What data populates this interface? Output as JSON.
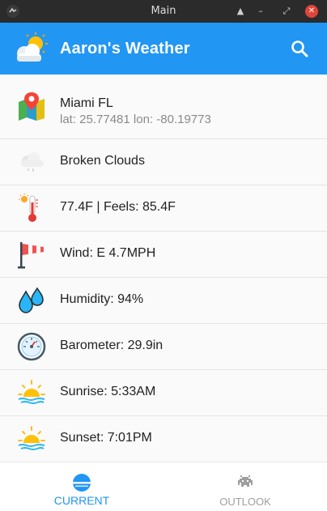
{
  "window": {
    "title": "Main"
  },
  "app": {
    "title": "Aaron's Weather"
  },
  "location": {
    "name": "Miami FL",
    "coords": "lat: 25.77481 lon: -80.19773"
  },
  "conditions": [
    {
      "label": "Broken Clouds",
      "icon": "cloud-icon"
    },
    {
      "label": "77.4F  |  Feels: 85.4F",
      "icon": "thermometer-icon"
    },
    {
      "label": "Wind: E 4.7MPH",
      "icon": "windsock-icon"
    },
    {
      "label": "Humidity: 94%",
      "icon": "water-drops-icon"
    },
    {
      "label": "Barometer: 29.9in",
      "icon": "barometer-icon"
    },
    {
      "label": "Sunrise:  5:33AM",
      "icon": "sunrise-icon"
    },
    {
      "label": "Sunset:  7:01PM",
      "icon": "sunset-icon"
    }
  ],
  "nav": {
    "current_label": "CURRENT",
    "outlook_label": "OUTLOOK"
  },
  "colors": {
    "primary": "#2196f3",
    "titlebar": "#2b2b2b",
    "close": "#e0453a"
  }
}
